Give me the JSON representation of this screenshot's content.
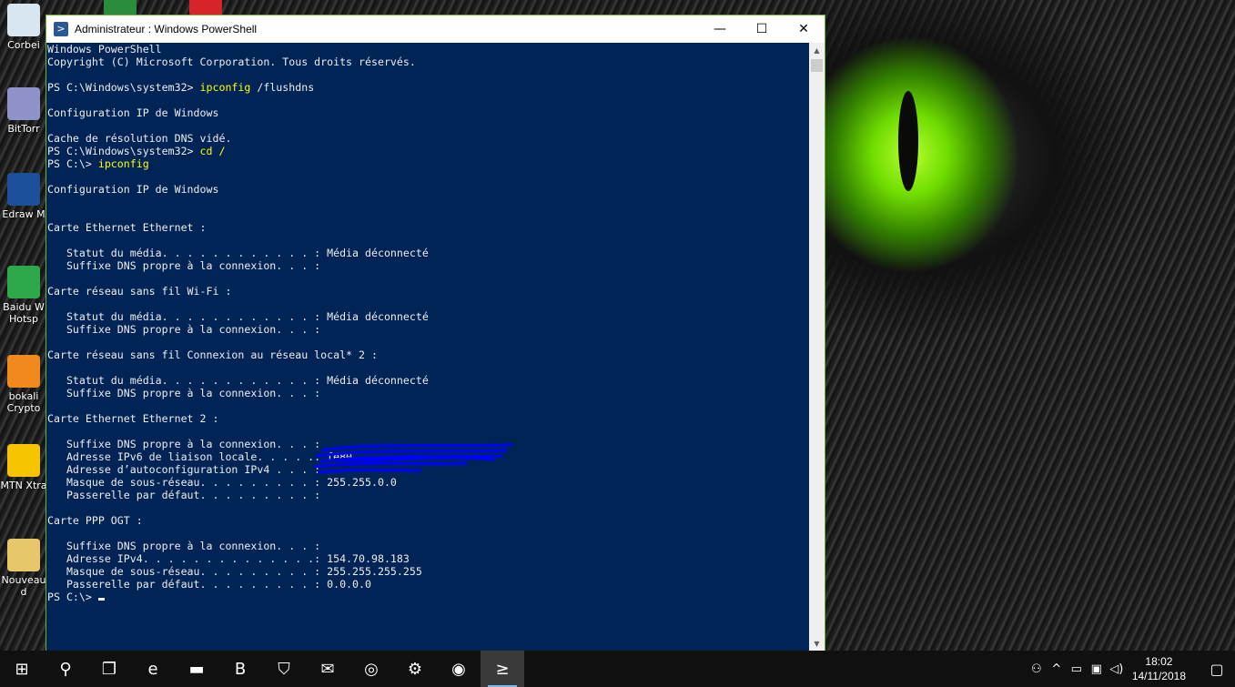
{
  "window": {
    "title": "Administrateur : Windows PowerShell",
    "minimize": "—",
    "maximize": "☐",
    "close": "✕"
  },
  "console_lines": [
    {
      "p": "Windows PowerShell"
    },
    {
      "p": "Copyright (C) Microsoft Corporation. Tous droits réservés."
    },
    {
      "p": ""
    },
    {
      "p": "PS C:\\Windows\\system32> ",
      "c": "ipconfig",
      "a": " /flushdns"
    },
    {
      "p": ""
    },
    {
      "p": "Configuration IP de Windows"
    },
    {
      "p": ""
    },
    {
      "p": "Cache de résolution DNS vidé."
    },
    {
      "p": "PS C:\\Windows\\system32> ",
      "c": "cd /"
    },
    {
      "p": "PS C:\\> ",
      "c": "ipconfig"
    },
    {
      "p": ""
    },
    {
      "p": "Configuration IP de Windows"
    },
    {
      "p": ""
    },
    {
      "p": ""
    },
    {
      "p": "Carte Ethernet Ethernet :"
    },
    {
      "p": ""
    },
    {
      "p": "   Statut du média. . . . . . . . . . . . : Média déconnecté"
    },
    {
      "p": "   Suffixe DNS propre à la connexion. . . :"
    },
    {
      "p": ""
    },
    {
      "p": "Carte réseau sans fil Wi-Fi :"
    },
    {
      "p": ""
    },
    {
      "p": "   Statut du média. . . . . . . . . . . . : Média déconnecté"
    },
    {
      "p": "   Suffixe DNS propre à la connexion. . . :"
    },
    {
      "p": ""
    },
    {
      "p": "Carte réseau sans fil Connexion au réseau local* 2 :"
    },
    {
      "p": ""
    },
    {
      "p": "   Statut du média. . . . . . . . . . . . : Média déconnecté"
    },
    {
      "p": "   Suffixe DNS propre à la connexion. . . :"
    },
    {
      "p": ""
    },
    {
      "p": "Carte Ethernet Ethernet 2 :"
    },
    {
      "p": ""
    },
    {
      "p": "   Suffixe DNS propre à la connexion. . . :"
    },
    {
      "p": "   Adresse IPv6 de liaison locale. . . . .: fe80"
    },
    {
      "p": "   Adresse d’autoconfiguration IPv4 . . . :"
    },
    {
      "p": "   Masque de sous-réseau. . . . . . . . . : 255.255.0.0"
    },
    {
      "p": "   Passerelle par défaut. . . . . . . . . :"
    },
    {
      "p": ""
    },
    {
      "p": "Carte PPP OGT :"
    },
    {
      "p": ""
    },
    {
      "p": "   Suffixe DNS propre à la connexion. . . :"
    },
    {
      "p": "   Adresse IPv4. . . . . . . . . . . . . .: 154.70.98.183"
    },
    {
      "p": "   Masque de sous-réseau. . . . . . . . . : 255.255.255.255"
    },
    {
      "p": "   Passerelle par défaut. . . . . . . . . : 0.0.0.0"
    },
    {
      "p": "PS C:\\> ",
      "cursor": true
    }
  ],
  "desktop_icons": [
    {
      "label": "Corbei",
      "icon": "recycle-bin-icon",
      "color": "#d8e6f2"
    },
    {
      "label": "BitTorr",
      "icon": "bittorrent-icon",
      "color": "#8f93c9"
    },
    {
      "label": "Edraw M",
      "icon": "edraw-icon",
      "color": "#1e4f9a"
    },
    {
      "label": "Baidu W Hotsp",
      "icon": "baidu-wifi-icon",
      "color": "#2ea84a"
    },
    {
      "label": "bokali Crypto",
      "icon": "bokali-icon",
      "color": "#f08a1c"
    },
    {
      "label": "MTN Xtra",
      "icon": "mtn-icon",
      "color": "#f6c400"
    },
    {
      "label": "Nouveau d",
      "icon": "folder-icon",
      "color": "#e8c76a"
    }
  ],
  "taskbar": {
    "items": [
      {
        "name": "start-button",
        "glyph": "⊞"
      },
      {
        "name": "search-icon",
        "glyph": "⚲"
      },
      {
        "name": "task-view-icon",
        "glyph": "❐"
      },
      {
        "name": "edge-icon",
        "glyph": "e"
      },
      {
        "name": "file-explorer-icon",
        "glyph": "▬"
      },
      {
        "name": "b-app-icon",
        "glyph": "B"
      },
      {
        "name": "store-icon",
        "glyph": "⛉"
      },
      {
        "name": "mail-icon",
        "glyph": "✉"
      },
      {
        "name": "bokali-taskbar-icon",
        "glyph": "◎"
      },
      {
        "name": "settings-icon",
        "glyph": "⚙"
      },
      {
        "name": "bittorrent-taskbar-icon",
        "glyph": "◉"
      },
      {
        "name": "powershell-taskbar-icon",
        "glyph": "≥"
      }
    ],
    "tray": {
      "people": "⚇",
      "chevron": "^",
      "battery": "▭",
      "network": "▣",
      "volume": "◁)",
      "time": "18:02",
      "date": "14/11/2018",
      "notification": "▢"
    }
  }
}
